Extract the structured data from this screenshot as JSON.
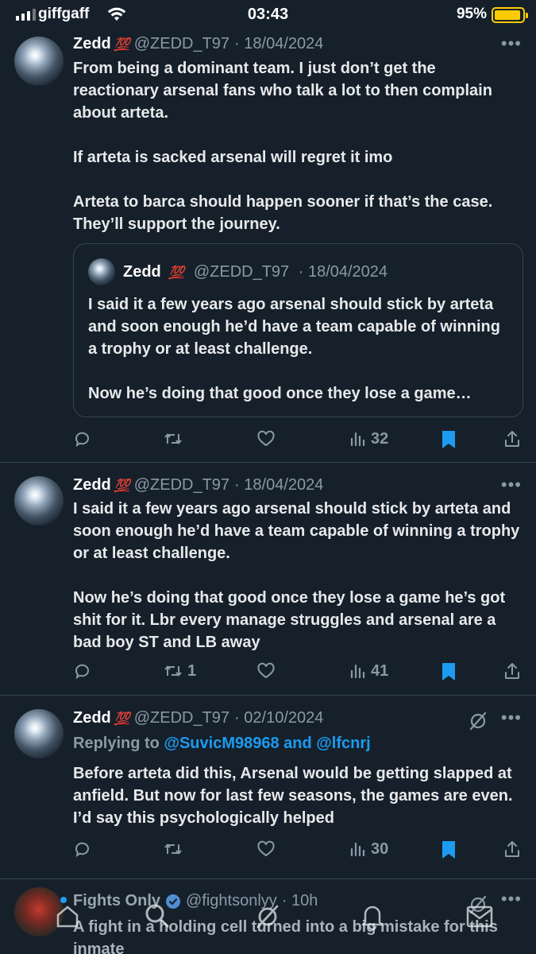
{
  "status": {
    "carrier": "giffgaff",
    "time": "03:43",
    "battery": "95%"
  },
  "tweets": [
    {
      "name": "Zedd",
      "emoji": "💯",
      "handle": "@ZEDD_T97",
      "date": "· 18/04/2024",
      "text": "From being a dominant team. I just don’t get the reactionary arsenal fans who talk a lot to then complain about arteta.\n\nIf arteta is sacked arsenal will regret it imo\n\nArteta to barca should happen sooner if that’s the case. They’ll support the journey.",
      "quote": {
        "name": "Zedd",
        "emoji": "💯",
        "handle": "@ZEDD_T97",
        "date": "· 18/04/2024",
        "text": "I said it a few years ago arsenal should stick by arteta and soon enough he’d have a team capable of winning a trophy or at least challenge.\n\nNow he’s doing that good once they lose a game…"
      },
      "replies": "",
      "retweets": "",
      "likes": "",
      "views": "32"
    },
    {
      "name": "Zedd",
      "emoji": "💯",
      "handle": "@ZEDD_T97",
      "date": "· 18/04/2024",
      "text": "I said it a few years ago arsenal should stick by arteta and soon enough he’d have a team capable of winning a trophy or at least challenge.\n\nNow he’s doing that good once they lose a game he’s got shit for it. Lbr every manage struggles and arsenal are a bad boy ST and LB away",
      "replies": "",
      "retweets": "1",
      "likes": "",
      "views": "41"
    },
    {
      "name": "Zedd",
      "emoji": "💯",
      "handle": "@ZEDD_T97",
      "date": "· 02/10/2024",
      "replying_prefix": "Replying to ",
      "replying_users": "@SuvicM98968 and @lfcnrj",
      "text": "Before arteta did this, Arsenal would be getting slapped at anfield. But now for last few seasons, the games are even. I’d say this psychologically helped",
      "replies": "",
      "retweets": "",
      "likes": "",
      "views": "30"
    }
  ],
  "promo_tweet": {
    "name": "Fights Only",
    "handle": "@fightsonlyy",
    "date": "· 10h",
    "text": "A fight in a holding cell turned into a big mistake for this inmate"
  },
  "icons": {
    "reply": "reply-icon",
    "retweet": "retweet-icon",
    "like": "like-icon",
    "views": "views-icon",
    "bookmark": "bookmark-icon",
    "share": "share-icon",
    "more": "more-icon",
    "grok": "grok-icon",
    "tabs": [
      "home-icon",
      "search-icon",
      "grok-icon",
      "notifications-icon",
      "messages-icon"
    ]
  },
  "colors": {
    "background": "#15202b",
    "accent": "#1d9bf0",
    "muted": "#8b98a5",
    "battery": "#fecc02",
    "emoji": "#ff2a2a"
  }
}
